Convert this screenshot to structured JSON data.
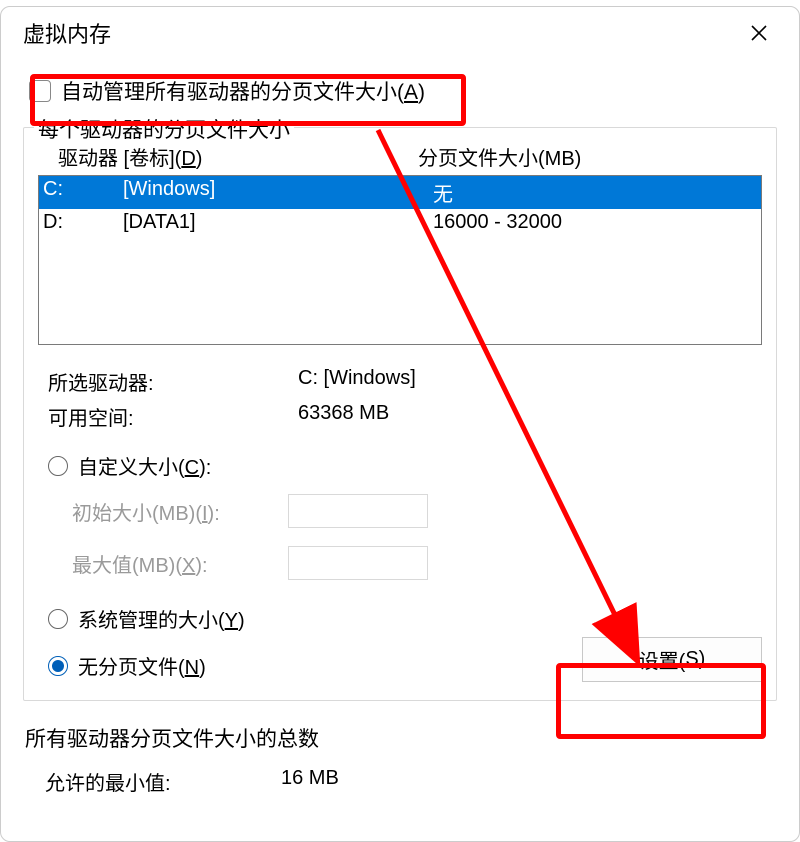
{
  "dialog": {
    "title": "虚拟内存"
  },
  "auto_manage": {
    "label": "自动管理所有驱动器的分页文件大小(A)",
    "accel": "A",
    "checked": false
  },
  "per_drive": {
    "title": "每个驱动器的分页文件大小",
    "header_drive": "驱动器 [卷标](D)",
    "header_drive_accel": "D",
    "header_size": "分页文件大小(MB)"
  },
  "drives": [
    {
      "letter": "C:",
      "label": "[Windows]",
      "size": "无",
      "selected": true
    },
    {
      "letter": "D:",
      "label": "[DATA1]",
      "size": "16000 - 32000",
      "selected": false
    }
  ],
  "selected_info": {
    "drive_label": "所选驱动器:",
    "drive_value": "C:  [Windows]",
    "free_label": "可用空间:",
    "free_value": "63368 MB"
  },
  "options": {
    "custom": {
      "label": "自定义大小(C):",
      "accel": "C",
      "selected": false
    },
    "initial": {
      "label": "初始大小(MB)(I):",
      "accel": "I",
      "value": ""
    },
    "maximum": {
      "label": "最大值(MB)(X):",
      "accel": "X",
      "value": ""
    },
    "system": {
      "label": "系统管理的大小(Y)",
      "accel": "Y",
      "selected": false
    },
    "none": {
      "label": "无分页文件(N)",
      "accel": "N",
      "selected": true
    }
  },
  "set_button": {
    "label": "设置(S)",
    "accel": "S"
  },
  "totals": {
    "title": "所有驱动器分页文件大小的总数",
    "min_label": "允许的最小值:",
    "min_value": "16 MB"
  },
  "annotation": {
    "color": "#ff0000"
  }
}
